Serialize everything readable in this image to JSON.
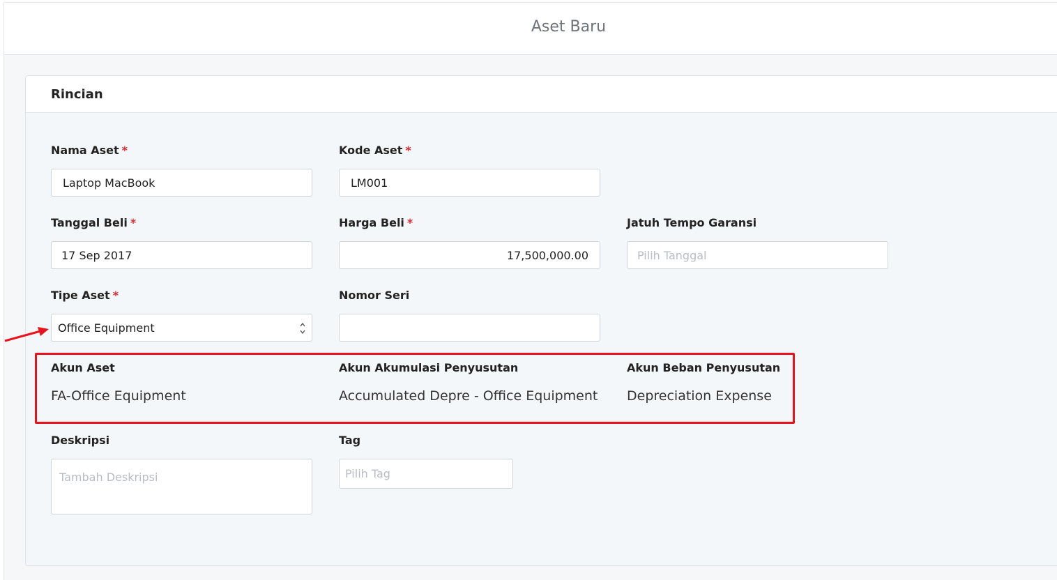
{
  "page": {
    "title": "Aset Baru"
  },
  "section": {
    "title": "Rincian"
  },
  "required_mark": "*",
  "fields": {
    "nama_aset": {
      "label": "Nama Aset",
      "value": "Laptop MacBook"
    },
    "kode_aset": {
      "label": "Kode Aset",
      "value": "LM001"
    },
    "tanggal_beli": {
      "label": "Tanggal Beli",
      "value": "17 Sep 2017"
    },
    "harga_beli": {
      "label": "Harga Beli",
      "value": "17,500,000.00"
    },
    "jatuh_tempo_garansi": {
      "label": "Jatuh Tempo Garansi",
      "placeholder": "Pilih Tanggal"
    },
    "tipe_aset": {
      "label": "Tipe Aset",
      "value": "Office Equipment"
    },
    "nomor_seri": {
      "label": "Nomor Seri",
      "value": ""
    },
    "deskripsi": {
      "label": "Deskripsi",
      "placeholder": "Tambah Deskripsi"
    },
    "tag": {
      "label": "Tag",
      "placeholder": "Pilih Tag"
    }
  },
  "accounts": {
    "akun_aset": {
      "label": "Akun Aset",
      "value": "FA-Office Equipment"
    },
    "akun_akumulasi": {
      "label": "Akun Akumulasi Penyusutan",
      "value": "Accumulated Depre - Office Equipment"
    },
    "akun_beban": {
      "label": "Akun Beban Penyusutan",
      "value": "Depreciation Expense"
    }
  },
  "colors": {
    "required": "#e3272f",
    "annotation": "#e8131d",
    "placeholder": "#b8bdc3"
  },
  "icons": {
    "select_arrows": "chevron-up-down-icon",
    "annotation_arrow": "arrow-right-icon"
  }
}
